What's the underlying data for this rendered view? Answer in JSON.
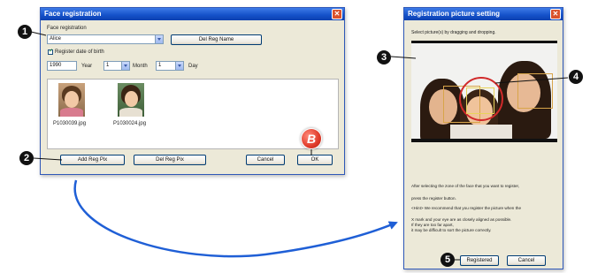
{
  "face_dialog": {
    "title": "Face registration",
    "group_label": "Face registration",
    "name_value": "Alice",
    "del_name_button": "Del Reg Name",
    "birth_checkbox_label": "Register date of birth",
    "birth_checked": true,
    "year_value": "1990",
    "year_label": "Year",
    "month_value": "1",
    "month_label": "Month",
    "day_value": "1",
    "day_label": "Day",
    "pictures": [
      {
        "caption": "P1030039.jpg"
      },
      {
        "caption": "P1030024.jpg"
      }
    ],
    "add_button": "Add Reg Pix",
    "del_button": "Del Reg Pix",
    "cancel_button": "Cancel",
    "ok_button": "OK"
  },
  "pic_dialog": {
    "title": "Registration picture setting",
    "instruction": "Select picture(s) by dragging and dropping.",
    "help_text_1": "After selecting the zone of the face that you want to register,",
    "help_text_2": "press the register button.",
    "note_1": "<Hint> We recommend that you register the picture when the",
    "note_2": "X mark and your eye are as closely aligned as possible.",
    "note_3": "If they are too far apart,",
    "note_4": "it may be difficult to sort the picture correctly.",
    "registered_button": "Registered",
    "cancel_button": "Cancel"
  },
  "callouts": {
    "one": "1",
    "two": "2",
    "three": "3",
    "four": "4",
    "five": "5",
    "b": "B"
  },
  "colors": {
    "titlebar": "#1450c8",
    "callout_red": "#e03b2a",
    "arrow_blue": "#1f5fd6"
  }
}
